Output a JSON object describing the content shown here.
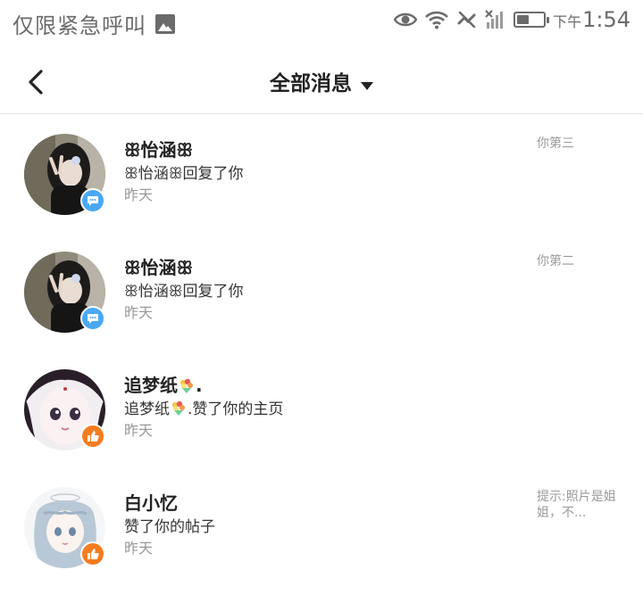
{
  "status_bar": {
    "carrier": "仅限紧急呼叫",
    "ampm": "下午",
    "time": "1:54",
    "icons": [
      "image-icon",
      "eye-icon",
      "wifi-icon",
      "no-call-icon",
      "no-signal-icon",
      "battery-icon"
    ],
    "battery_level": 0.45
  },
  "header": {
    "title": "全部消息",
    "back_icon": "chevron-left-icon",
    "dropdown_icon": "caret-down-icon"
  },
  "messages": [
    {
      "name": "ꕥ怡涵ꕥ",
      "text": "ꕥ怡涵ꕥ回复了你",
      "time": "昨天",
      "preview": "你第三",
      "badge": "comment",
      "badge_color": "#4aa8f5"
    },
    {
      "name": "ꕥ怡涵ꕥ",
      "text": "ꕥ怡涵ꕥ回复了你",
      "time": "昨天",
      "preview": "你第二",
      "badge": "comment",
      "badge_color": "#4aa8f5"
    },
    {
      "name": "追梦纸",
      "name_suffix": ".",
      "text": "追梦纸",
      "text_suffix": ".赞了你的主页",
      "time": "昨天",
      "preview": "",
      "badge": "like",
      "badge_color": "#f57c1f"
    },
    {
      "name": "白小忆",
      "text": "赞了你的帖子",
      "time": "昨天",
      "preview": "提示:照片是姐姐，不...",
      "badge": "like",
      "badge_color": "#f57c1f"
    }
  ]
}
